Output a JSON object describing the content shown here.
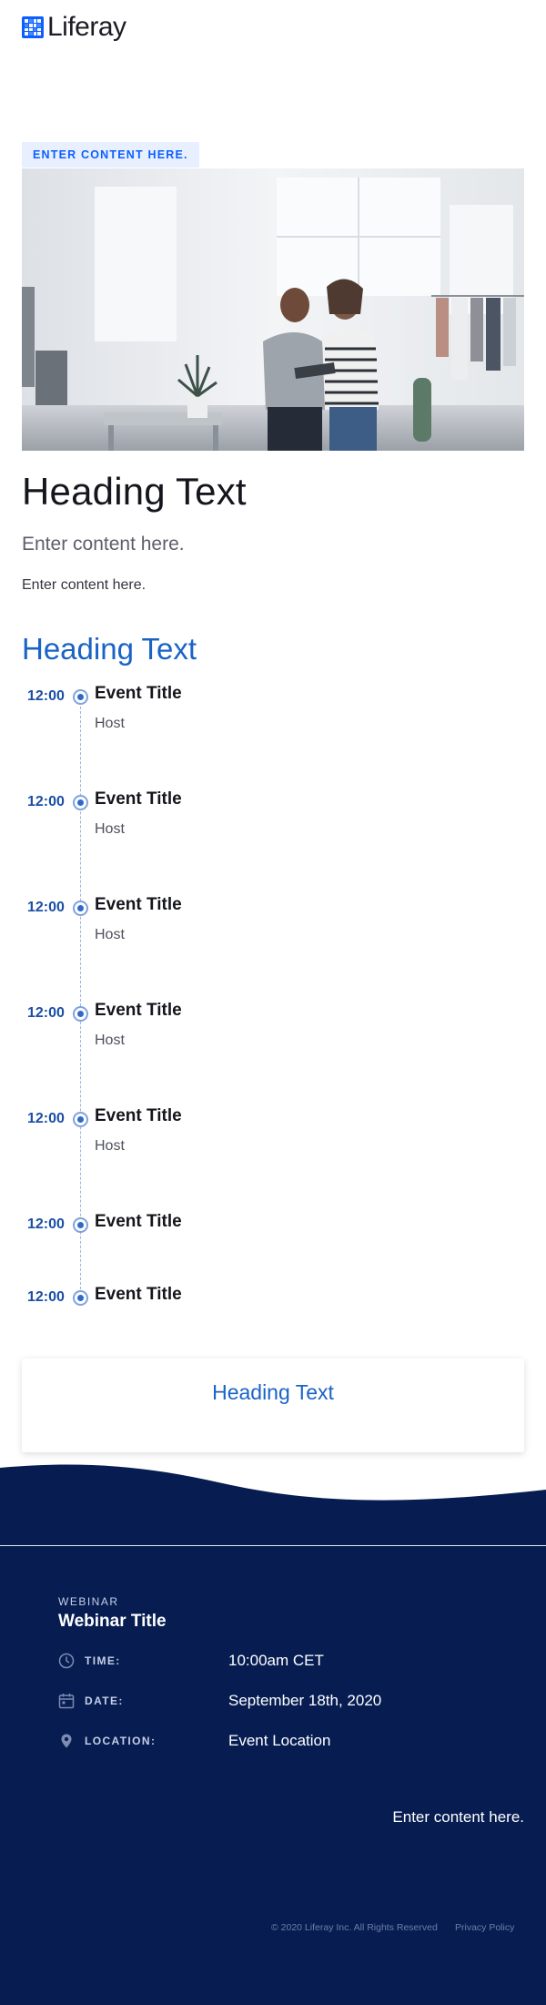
{
  "header": {
    "logo_text": "Liferay"
  },
  "hero": {
    "eyebrow": "ENTER CONTENT HERE.",
    "image_icon": "store-photo"
  },
  "intro": {
    "heading": "Heading Text",
    "lead": "Enter content here.",
    "body": "Enter content here."
  },
  "agenda": {
    "heading": "Heading Text",
    "items": [
      {
        "time": "12:00",
        "title": "Event Title",
        "host": "Host"
      },
      {
        "time": "12:00",
        "title": "Event Title",
        "host": "Host"
      },
      {
        "time": "12:00",
        "title": "Event Title",
        "host": "Host"
      },
      {
        "time": "12:00",
        "title": "Event Title",
        "host": "Host"
      },
      {
        "time": "12:00",
        "title": "Event Title",
        "host": "Host"
      },
      {
        "time": "12:00",
        "title": "Event Title"
      },
      {
        "time": "12:00",
        "title": "Event Title"
      }
    ]
  },
  "card": {
    "heading": "Heading Text"
  },
  "footer": {
    "kicker": "WEBINAR",
    "title": "Webinar Title",
    "rows": [
      {
        "icon": "clock-icon",
        "label": "TIME:",
        "value": "10:00am CET"
      },
      {
        "icon": "calendar-icon",
        "label": "DATE:",
        "value": "September 18th, 2020"
      },
      {
        "icon": "location-pin-icon",
        "label": "LOCATION:",
        "value": "Event Location"
      }
    ],
    "content": "Enter content here.",
    "copyright": "© 2020 Liferay Inc. All Rights Reserved",
    "privacy": "Privacy Policy"
  },
  "colors": {
    "brand_blue": "#0b5fff",
    "heading_blue": "#1a63c6",
    "footer_navy": "#071d52"
  }
}
